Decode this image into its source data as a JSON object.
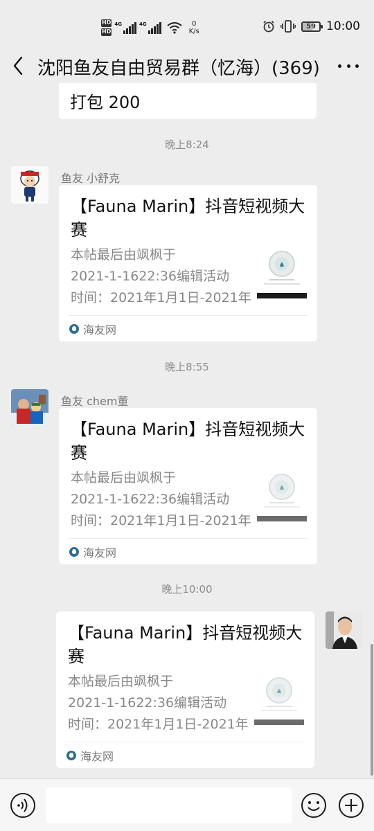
{
  "status_bar": {
    "hd_1": "HD",
    "hd_2": "HD",
    "net_1": "4G",
    "net_2": "4G",
    "speed_value": "0",
    "speed_unit": "K/s",
    "battery": "59",
    "time": "10:00"
  },
  "header": {
    "title": "沈阳鱼友自由贸易群（忆海）(369)"
  },
  "messages": {
    "top_partial_text": "打包 200",
    "timestamps": [
      "晚上8:24",
      "晚上8:55",
      "晚上10:00"
    ],
    "senders": [
      "鱼友 小舒克",
      "鱼友 chem董"
    ],
    "cards": [
      {
        "title": "【Fauna Marin】抖音短视频大赛",
        "desc_1": "本帖最后由飒枫于",
        "desc_2": "2021-1-1622:36编辑活动",
        "desc_3": "时间：2021年1月1日-2021年",
        "source": "海友网"
      },
      {
        "title": "【Fauna Marin】抖音短视频大赛",
        "desc_1": "本帖最后由飒枫于",
        "desc_2": "2021-1-1622:36编辑活动",
        "desc_3": "时间：2021年1月1日-2021年",
        "source": "海友网"
      },
      {
        "title": "【Fauna Marin】抖音短视频大赛",
        "desc_1": "本帖最后由飒枫于",
        "desc_2": "2021-1-1622:36编辑活动",
        "desc_3": "时间：2021年1月1日-2021年",
        "source": "海友网"
      }
    ]
  },
  "input": {
    "placeholder": ""
  },
  "icons": {
    "back": "back-chevron-icon",
    "more": "more-dots-icon",
    "voice": "voice-icon",
    "emoji": "emoji-icon",
    "plus": "plus-icon",
    "alarm": "alarm-icon",
    "vibrate": "vibrate-icon",
    "wifi": "wifi-icon"
  }
}
